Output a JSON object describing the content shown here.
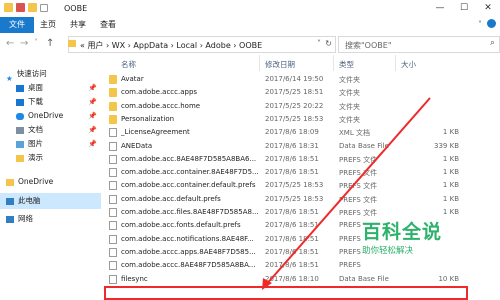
{
  "window": {
    "title": "OOBE",
    "controls": [
      "—",
      "☐",
      "✕"
    ]
  },
  "ribbon": {
    "tabs": [
      "文件",
      "主页",
      "共享",
      "查看"
    ]
  },
  "address": {
    "path": "«  用户  ›  WX  ›  AppData  ›  Local  ›  Adobe  ›  OOBE",
    "chevron": "˅",
    "refresh": "↻"
  },
  "search": {
    "placeholder": "搜索\"OOBE\""
  },
  "sidebar": {
    "items": [
      {
        "label": "快速访问",
        "icon": "star-icon",
        "color": "#1e88e5",
        "pinned": false
      },
      {
        "label": "桌面",
        "icon": "desktop-icon",
        "color": "#1976d2",
        "pinned": true
      },
      {
        "label": "下载",
        "icon": "download-icon",
        "color": "#1976d2",
        "pinned": true
      },
      {
        "label": "OneDrive",
        "icon": "cloud-icon",
        "color": "#1e88e5",
        "pinned": true
      },
      {
        "label": "文档",
        "icon": "document-icon",
        "color": "#7d8fa3",
        "pinned": true
      },
      {
        "label": "图片",
        "icon": "picture-icon",
        "color": "#5aa3d9",
        "pinned": true
      },
      {
        "label": "演示",
        "icon": "folder-icon",
        "color": "#f3c54b",
        "pinned": false
      },
      {
        "label": "OneDrive",
        "icon": "cloud-icon",
        "color": "#1e88e5",
        "pinned": false
      },
      {
        "label": "此电脑",
        "icon": "computer-icon",
        "color": "#2f7fc1",
        "pinned": false
      },
      {
        "label": "网络",
        "icon": "network-icon",
        "color": "#2f7fc1",
        "pinned": false
      }
    ],
    "pin_glyph": "📌"
  },
  "columns": {
    "name": "名称",
    "date": "修改日期",
    "type": "类型",
    "size": "大小"
  },
  "files": [
    {
      "name": "Avatar",
      "date": "2017/6/14 19:50",
      "type": "文件夹",
      "size": "",
      "kind": "folder"
    },
    {
      "name": "com.adobe.accc.apps",
      "date": "2017/5/25 18:51",
      "type": "文件夹",
      "size": "",
      "kind": "folder"
    },
    {
      "name": "com.adobe.accc.home",
      "date": "2017/5/25 20:22",
      "type": "文件夹",
      "size": "",
      "kind": "folder"
    },
    {
      "name": "Personalization",
      "date": "2017/5/25 18:53",
      "type": "文件夹",
      "size": "",
      "kind": "folder"
    },
    {
      "name": "_LicenseAgreement",
      "date": "2017/8/6 18:09",
      "type": "XML 文档",
      "size": "1 KB",
      "kind": "file"
    },
    {
      "name": "ANEData",
      "date": "2017/8/6 18:31",
      "type": "Data Base File",
      "size": "339 KB",
      "kind": "file"
    },
    {
      "name": "com.adobe.acc.8AE48F7D585A8BA6...",
      "date": "2017/8/6 18:51",
      "type": "PREFS 文件",
      "size": "1 KB",
      "kind": "file"
    },
    {
      "name": "com.adobe.acc.container.8AE48F7D5...",
      "date": "2017/8/6 18:51",
      "type": "PREFS 文件",
      "size": "1 KB",
      "kind": "file"
    },
    {
      "name": "com.adobe.acc.container.default.prefs",
      "date": "2017/5/25 18:53",
      "type": "PREFS 文件",
      "size": "1 KB",
      "kind": "file"
    },
    {
      "name": "com.adobe.acc.default.prefs",
      "date": "2017/5/25 18:53",
      "type": "PREFS 文件",
      "size": "1 KB",
      "kind": "file"
    },
    {
      "name": "com.adobe.acc.files.8AE48F7D585A8...",
      "date": "2017/8/6 18:51",
      "type": "PREFS 文件",
      "size": "1 KB",
      "kind": "file"
    },
    {
      "name": "com.adobe.acc.fonts.default.prefs",
      "date": "2017/8/6 18:51",
      "type": "PREFS",
      "size": "",
      "kind": "file"
    },
    {
      "name": "com.adobe.acc.notifications.8AE48F...",
      "date": "2017/8/6 18:51",
      "type": "PREFS",
      "size": "",
      "kind": "file"
    },
    {
      "name": "com.adobe.accc.apps.8AE48F7D585...",
      "date": "2017/8/6 18:51",
      "type": "PREFS",
      "size": "",
      "kind": "file"
    },
    {
      "name": "com.adobe.accc.8AE48F7D585A8BA...",
      "date": "2017/8/6 18:51",
      "type": "PREFS",
      "size": "",
      "kind": "file"
    },
    {
      "name": "filesync",
      "date": "2017/8/6 18:10",
      "type": "Data Base File",
      "size": "10 KB",
      "kind": "file"
    }
  ],
  "watermark": {
    "big": "百科全说",
    "small": "助你轻松解决"
  },
  "colors": {
    "accent": "#1979ca",
    "highlight": "#ef2a2a",
    "brand": "#2db26b"
  }
}
